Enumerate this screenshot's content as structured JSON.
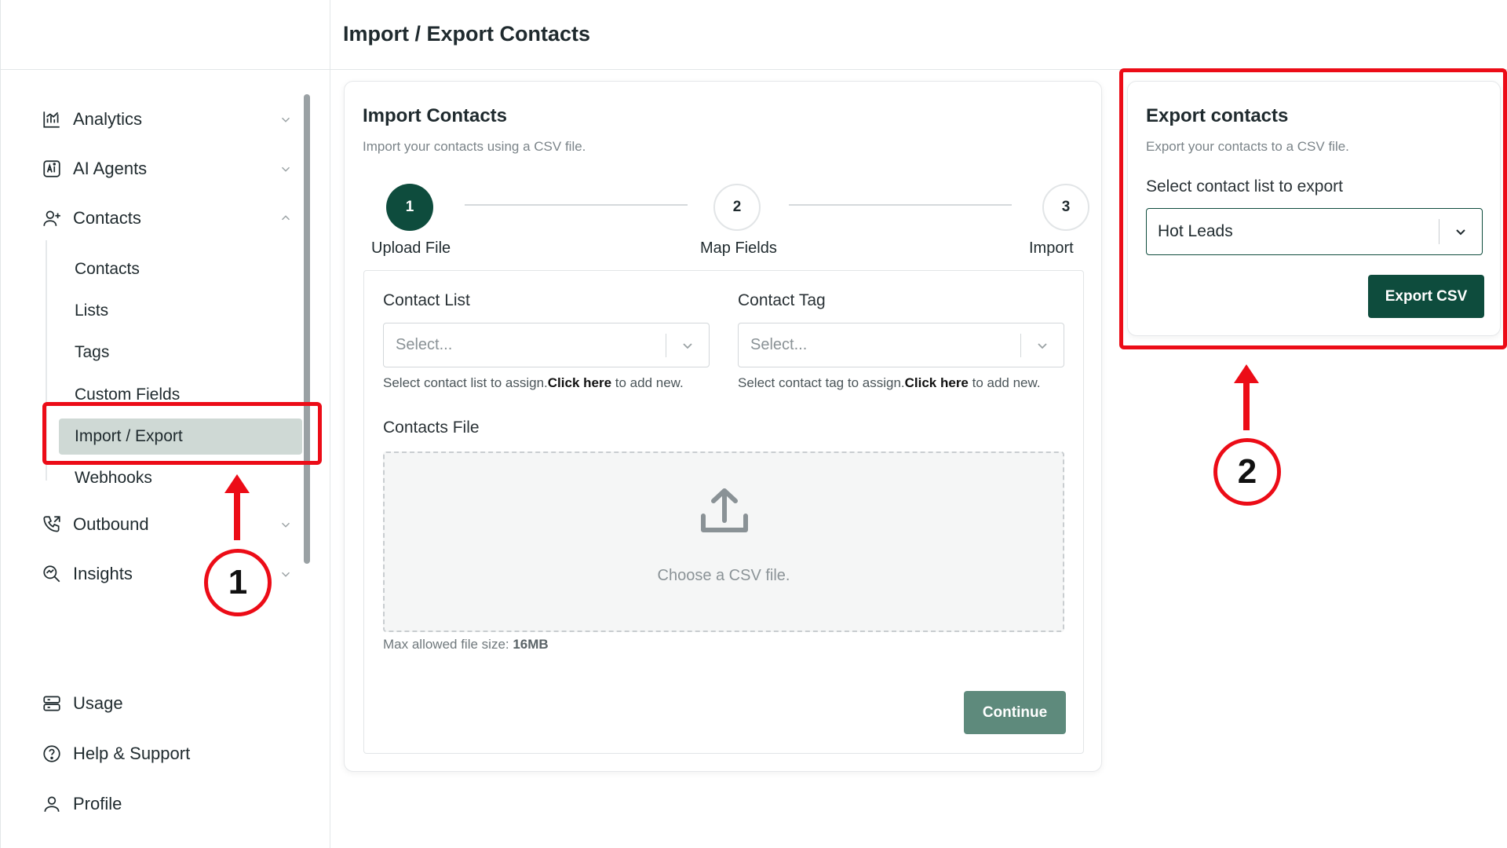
{
  "sidebar": {
    "groups": [
      {
        "label": "Analytics",
        "icon": "analytics-icon",
        "chevron": "down"
      },
      {
        "label": "AI Agents",
        "icon": "ai-agents-icon",
        "chevron": "down"
      },
      {
        "label": "Contacts",
        "icon": "contacts-icon",
        "chevron": "up"
      },
      {
        "label": "Outbound",
        "icon": "phone-outbound-icon",
        "chevron": "down"
      },
      {
        "label": "Insights",
        "icon": "insights-icon",
        "chevron": "down"
      }
    ],
    "contacts_sub": [
      "Contacts",
      "Lists",
      "Tags",
      "Custom Fields",
      "Import / Export",
      "Webhooks"
    ],
    "active_sub": "Import / Export",
    "bottom": [
      {
        "label": "Usage",
        "icon": "usage-icon"
      },
      {
        "label": "Help & Support",
        "icon": "help-icon"
      },
      {
        "label": "Profile",
        "icon": "profile-icon"
      }
    ]
  },
  "header": {
    "title": "Import / Export Contacts"
  },
  "import": {
    "title": "Import Contacts",
    "subtitle": "Import your contacts using a CSV file.",
    "steps": [
      {
        "num": "1",
        "label": "Upload File",
        "status": "active"
      },
      {
        "num": "2",
        "label": "Map Fields",
        "status": "pending"
      },
      {
        "num": "3",
        "label": "Import",
        "status": "pending"
      }
    ],
    "contact_list": {
      "label": "Contact List",
      "placeholder": "Select...",
      "helper_prefix": "Select contact list to assign.",
      "helper_link": "Click here",
      "helper_suffix": " to add new."
    },
    "contact_tag": {
      "label": "Contact Tag",
      "placeholder": "Select...",
      "helper_prefix": "Select contact tag to assign.",
      "helper_link": "Click here",
      "helper_suffix": " to add new."
    },
    "file": {
      "label": "Contacts File",
      "dropzone_text": "Choose a CSV file.",
      "max_prefix": "Max allowed file size: ",
      "max_value": "16MB"
    },
    "continue_label": "Continue"
  },
  "export": {
    "title": "Export contacts",
    "subtitle": "Export your contacts to a CSV file.",
    "select_label": "Select contact list to export",
    "selected_value": "Hot Leads",
    "button_label": "Export CSV"
  },
  "annotations": {
    "first": "1",
    "second": "2",
    "color": "#ec0c17"
  },
  "colors": {
    "primary": "#0e4c3d",
    "continue": "#5e8a7c",
    "active_nav": "#cfd9d5"
  }
}
